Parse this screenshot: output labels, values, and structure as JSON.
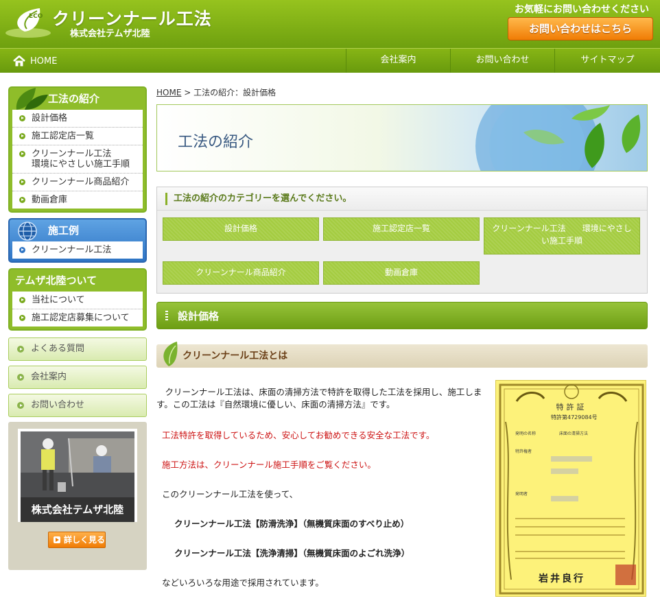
{
  "header": {
    "logo_mark": "ECO",
    "site_title": "クリーンナール工法",
    "company": "株式会社テムザ北陸",
    "contact_prompt": "お気軽にお問い合わせください",
    "contact_button": "お問い合わせはこちら"
  },
  "nav": {
    "home": "HOME",
    "items": [
      "会社案内",
      "お問い合わせ",
      "サイトマップ"
    ]
  },
  "sidebar": {
    "method_section": {
      "title": "工法の紹介",
      "items": [
        "設計価格",
        "施工認定店一覧",
        "クリーンナール工法",
        "環境にやさしい施工手順",
        "クリーンナール商品紹介",
        "動画倉庫"
      ]
    },
    "examples_section": {
      "title": "施工例",
      "items": [
        "クリーンナール工法"
      ]
    },
    "about_section": {
      "title": "テムザ北陸ついて",
      "items": [
        "当社について",
        "施工認定店募集について"
      ]
    },
    "flat_links": [
      "よくある質問",
      "会社案内",
      "お問い合わせ"
    ],
    "banner_caption": "株式会社テムザ北陸",
    "detail_button": "詳しく見る"
  },
  "main": {
    "breadcrumb": {
      "home": "HOME",
      "sep": " > ",
      "current": "工法の紹介：設計価格"
    },
    "hero_title": "工法の紹介",
    "category_heading": "工法の紹介のカテゴリーを選んでください。",
    "categories": [
      "設計価格",
      "施工認定店一覧",
      "クリーンナール工法　　環境にやさしい施工手順",
      "クリーンナール商品紹介",
      "動画倉庫"
    ],
    "section_title": "設計価格",
    "sub_title": "クリーンナール工法とは",
    "paragraphs": {
      "p1": "　クリーンナール工法は、床面の清掃方法で特許を取得した工法を採用し、施工します。この工法は『自然環境に優しい、床面の清掃方法』です。",
      "p2": "工法特許を取得しているため、安心してお勧めできる安全な工法です。",
      "p3": "施工方法は、クリーンナール施工手順をご覧ください。",
      "p4": "このクリーンナール工法を使って、",
      "p5": "クリーンナール工法【防滑洗浄】（無機質床面のすべり止め）",
      "p6": "クリーンナール工法【洗浄清掃】（無機質床面のよごれ洗浄）",
      "p7": "などいろいろな用途で採用されています。"
    },
    "certificate": {
      "title": "特許証",
      "number": "特許第4729084号",
      "row1_label": "発明の名称",
      "row1_value": "床面の清掃方法",
      "row2_label": "特許権者",
      "row3_label": "発明者",
      "signature": "岩井良行"
    }
  },
  "colors": {
    "accent_green": "#7fb024",
    "cta_orange": "#f07c05",
    "text_red": "#cc1111",
    "blue_head": "#2e74c4"
  }
}
